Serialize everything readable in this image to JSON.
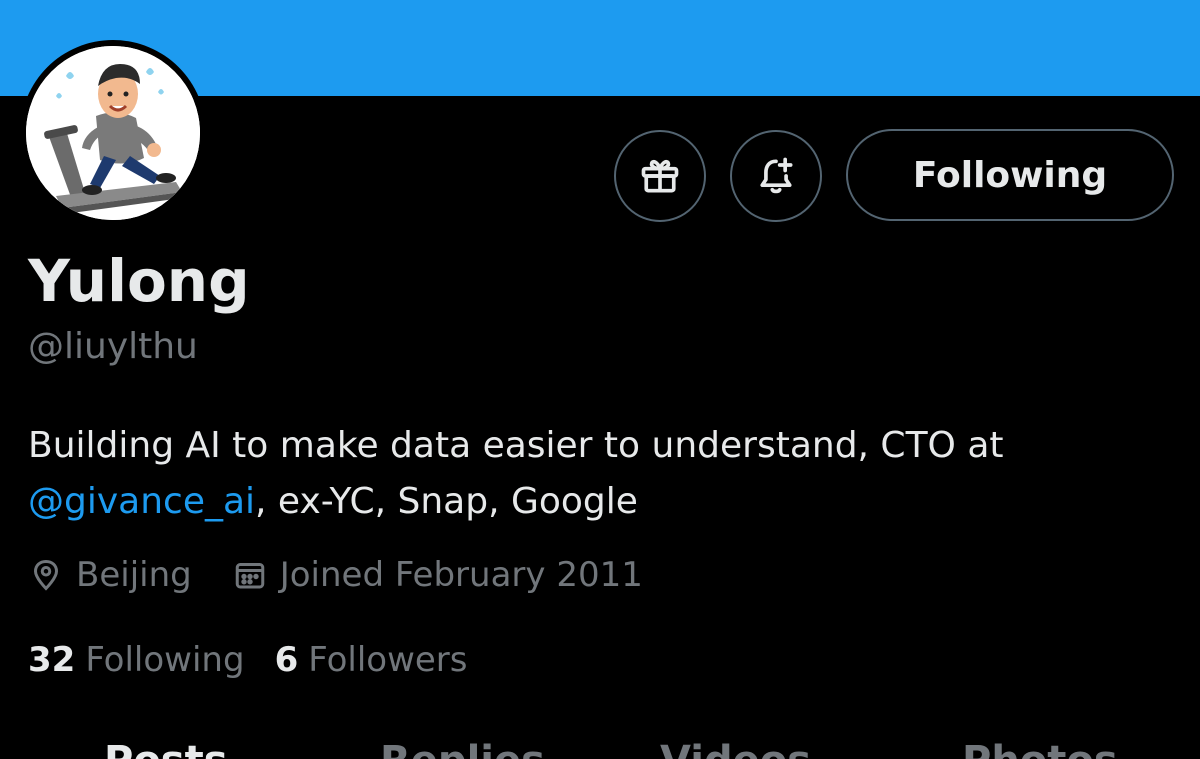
{
  "header": {
    "banner_color": "#1d9bf0"
  },
  "profile": {
    "display_name": "Yulong",
    "handle": "@liuylthu",
    "bio_text": "Building AI to make data easier to understand, CTO at ",
    "bio_mention": "@givance_ai",
    "bio_rest": ", ex-YC, Snap, Google",
    "location": "Beijing",
    "joined": "Joined February 2011"
  },
  "actions": {
    "gift_icon": "gift-icon",
    "bell_icon": "bell-plus-icon",
    "follow_label": "Following"
  },
  "stats": {
    "following_count": "32",
    "following_label": "Following",
    "followers_count": "6",
    "followers_label": "Followers"
  },
  "tabs": [
    {
      "label": "Posts"
    },
    {
      "label": "Replies"
    },
    {
      "label": "Videos"
    },
    {
      "label": "Photos"
    }
  ],
  "colors": {
    "accent": "#1d9bf0",
    "text_primary": "#e7e9ea",
    "text_secondary": "#71767b",
    "border": "#536471",
    "background": "#000000"
  }
}
